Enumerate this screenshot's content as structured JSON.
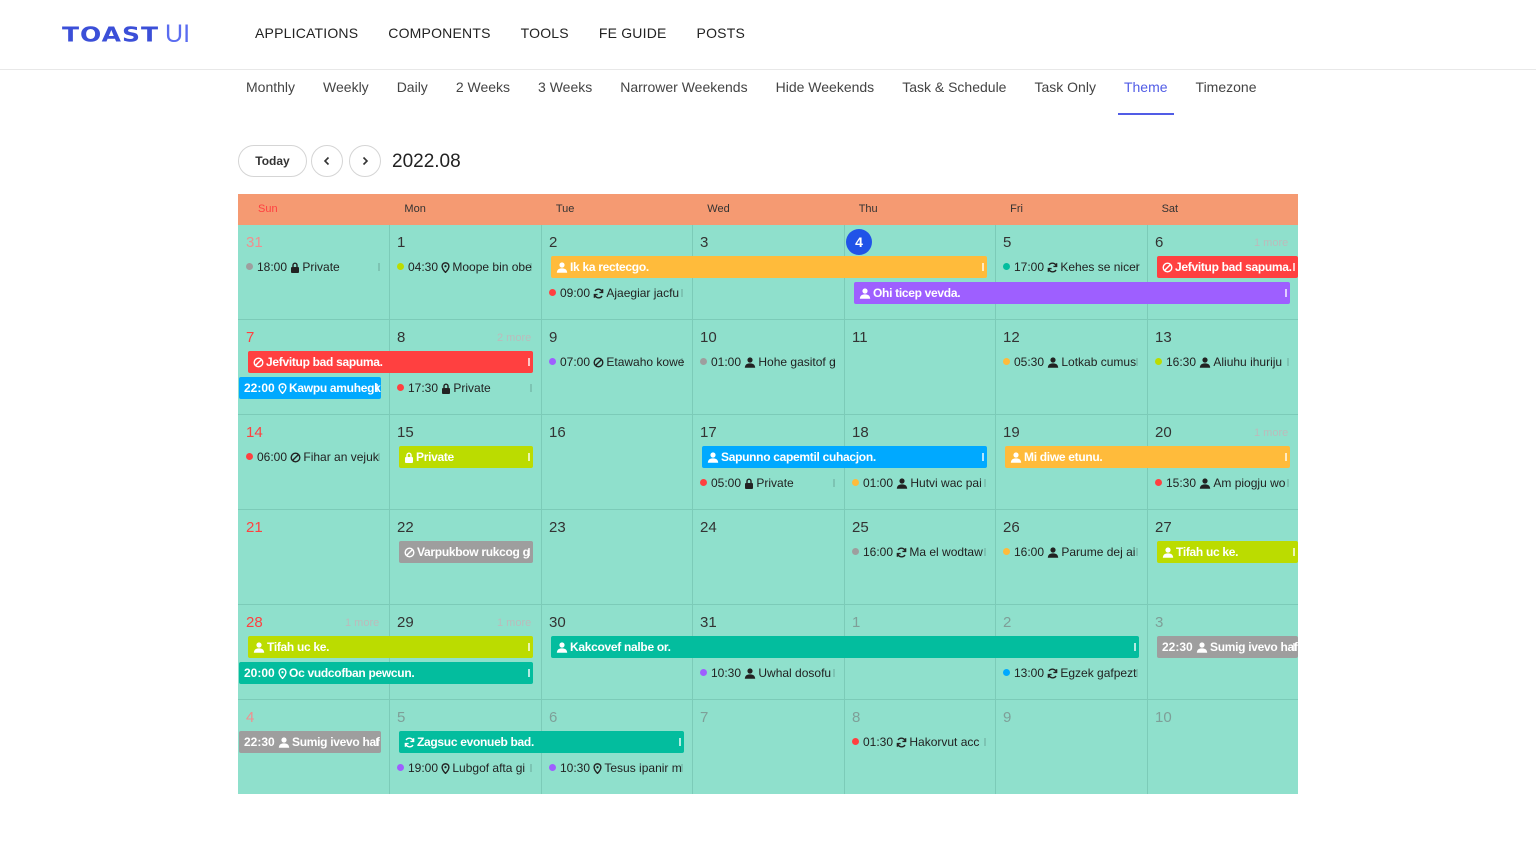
{
  "header": {
    "logo_main": "TOAST",
    "logo_sub": "UI",
    "nav": [
      "APPLICATIONS",
      "COMPONENTS",
      "TOOLS",
      "FE GUIDE",
      "POSTS"
    ]
  },
  "tabs": [
    "Monthly",
    "Weekly",
    "Daily",
    "2 Weeks",
    "3 Weeks",
    "Narrower Weekends",
    "Hide Weekends",
    "Task & Schedule",
    "Task Only",
    "Theme",
    "Timezone"
  ],
  "active_tab": "Theme",
  "toolbar": {
    "today_label": "Today",
    "range": "2022.08"
  },
  "calendar": {
    "day_names": [
      "Sun",
      "Mon",
      "Tue",
      "Wed",
      "Thu",
      "Fri",
      "Sat"
    ],
    "theme": {
      "header_bg": "#f59a72",
      "grid_bg": "#8fe0cc",
      "sunday": "#ff4040",
      "today": "#2053e8"
    },
    "weeks": [
      {
        "dates": [
          "31",
          "1",
          "2",
          "3",
          "4",
          "5",
          "6"
        ],
        "prev_month": [
          0
        ],
        "next_month": [],
        "today": 4,
        "more": {
          "6": "1 more"
        }
      },
      {
        "dates": [
          "7",
          "8",
          "9",
          "10",
          "11",
          "12",
          "13"
        ],
        "prev_month": [],
        "next_month": [],
        "more": {
          "1": "2 more"
        }
      },
      {
        "dates": [
          "14",
          "15",
          "16",
          "17",
          "18",
          "19",
          "20"
        ],
        "prev_month": [],
        "next_month": [],
        "more": {
          "6": "1 more"
        }
      },
      {
        "dates": [
          "21",
          "22",
          "23",
          "24",
          "25",
          "26",
          "27"
        ],
        "prev_month": [],
        "next_month": [],
        "more": {}
      },
      {
        "dates": [
          "28",
          "29",
          "30",
          "31",
          "1",
          "2",
          "3"
        ],
        "prev_month": [],
        "next_month": [
          4,
          5,
          6
        ],
        "more": {
          "0": "1 more",
          "1": "1 more"
        }
      },
      {
        "dates": [
          "4",
          "5",
          "6",
          "7",
          "8",
          "9",
          "10"
        ],
        "prev_month": [],
        "next_month": [
          0,
          1,
          2,
          3,
          4,
          5,
          6
        ],
        "more": {}
      }
    ],
    "events": [
      {
        "week": 0,
        "day": 0,
        "row": 0,
        "kind": "dot",
        "color": "#9e9e9e",
        "time": "18:00",
        "icon": "lock",
        "title": "Private"
      },
      {
        "week": 0,
        "day": 1,
        "row": 0,
        "kind": "dot",
        "color": "#bbdc00",
        "time": "04:30",
        "icon": "pin",
        "title": "Moope bin obe"
      },
      {
        "week": 0,
        "day": 2,
        "row": 0,
        "span": 3,
        "kind": "bar",
        "color": "#ffbb3b",
        "icon": "user",
        "title": "Ik ka rectecgo."
      },
      {
        "week": 0,
        "day": 5,
        "row": 0,
        "kind": "dot",
        "color": "#03bd9e",
        "time": "17:00",
        "icon": "repeat",
        "title": "Kehes se nicer"
      },
      {
        "week": 0,
        "day": 6,
        "row": 0,
        "kind": "bar",
        "color": "#ff4040",
        "icon": "ban",
        "title": "Jefvitup bad sapuma."
      },
      {
        "week": 0,
        "day": 2,
        "row": 1,
        "kind": "dot",
        "color": "#ff4040",
        "time": "09:00",
        "icon": "repeat",
        "title": "Ajaegiar jacfu"
      },
      {
        "week": 0,
        "day": 4,
        "row": 1,
        "span": 3,
        "kind": "bar",
        "color": "#9e5fff",
        "icon": "user",
        "title": "Ohi ticep vevda."
      },
      {
        "week": 1,
        "day": 0,
        "row": 0,
        "span": 2,
        "kind": "bar",
        "color": "#ff4040",
        "icon": "ban",
        "title": "Jefvitup bad sapuma."
      },
      {
        "week": 1,
        "day": 2,
        "row": 0,
        "kind": "dot",
        "color": "#9e5fff",
        "time": "07:00",
        "icon": "ban",
        "title": "Etawaho kowe"
      },
      {
        "week": 1,
        "day": 3,
        "row": 0,
        "kind": "dot",
        "color": "#9e9e9e",
        "time": "01:00",
        "icon": "user",
        "title": "Hohe gasitof g"
      },
      {
        "week": 1,
        "day": 5,
        "row": 0,
        "kind": "dot",
        "color": "#ffbb3b",
        "time": "05:30",
        "icon": "user",
        "title": "Lotkab cumus"
      },
      {
        "week": 1,
        "day": 6,
        "row": 0,
        "kind": "dot",
        "color": "#bbdc00",
        "time": "16:30",
        "icon": "user",
        "title": "Aliuhu ihuriju"
      },
      {
        "week": 1,
        "day": 0,
        "row": 1,
        "kind": "bar",
        "color": "#00a9ff",
        "time": "22:00",
        "icon": "pin",
        "title": "Kawpu amuhegk"
      },
      {
        "week": 1,
        "day": 1,
        "row": 1,
        "kind": "dot",
        "color": "#ff4040",
        "time": "17:30",
        "icon": "lock",
        "title": "Private"
      },
      {
        "week": 2,
        "day": 0,
        "row": 0,
        "kind": "dot",
        "color": "#ff4040",
        "time": "06:00",
        "icon": "ban",
        "title": "Fihar an vejuk"
      },
      {
        "week": 2,
        "day": 1,
        "row": 0,
        "kind": "bar",
        "color": "#bbdc00",
        "icon": "lock",
        "title": "Private"
      },
      {
        "week": 2,
        "day": 3,
        "row": 0,
        "span": 2,
        "kind": "bar",
        "color": "#00a9ff",
        "icon": "user",
        "title": "Sapunno capemtil cuhacjon."
      },
      {
        "week": 2,
        "day": 5,
        "row": 0,
        "span": 2,
        "kind": "bar",
        "color": "#ffbb3b",
        "icon": "user",
        "title": "Mi diwe etunu."
      },
      {
        "week": 2,
        "day": 3,
        "row": 1,
        "kind": "dot",
        "color": "#ff4040",
        "time": "05:00",
        "icon": "lock",
        "title": "Private"
      },
      {
        "week": 2,
        "day": 4,
        "row": 1,
        "kind": "dot",
        "color": "#ffbb3b",
        "time": "01:00",
        "icon": "user",
        "title": "Hutvi wac pai"
      },
      {
        "week": 2,
        "day": 6,
        "row": 1,
        "kind": "dot",
        "color": "#ff4040",
        "time": "15:30",
        "icon": "user",
        "title": "Am piogju wo"
      },
      {
        "week": 3,
        "day": 1,
        "row": 0,
        "kind": "bar",
        "color": "#9e9e9e",
        "icon": "ban",
        "title": "Varpukbow rukcog g"
      },
      {
        "week": 3,
        "day": 4,
        "row": 0,
        "kind": "dot",
        "color": "#9e9e9e",
        "time": "16:00",
        "icon": "repeat",
        "title": "Ma el wodtaw"
      },
      {
        "week": 3,
        "day": 5,
        "row": 0,
        "kind": "dot",
        "color": "#ffbb3b",
        "time": "16:00",
        "icon": "user",
        "title": "Parume dej ai"
      },
      {
        "week": 3,
        "day": 6,
        "row": 0,
        "kind": "bar",
        "color": "#bbdc00",
        "icon": "user",
        "title": "Tifah uc ke."
      },
      {
        "week": 4,
        "day": 0,
        "row": 0,
        "span": 2,
        "kind": "bar",
        "color": "#bbdc00",
        "icon": "user",
        "title": "Tifah uc ke."
      },
      {
        "week": 4,
        "day": 2,
        "row": 0,
        "span": 4,
        "kind": "bar",
        "color": "#03bd9e",
        "icon": "user",
        "title": "Kakcovef nalbe or."
      },
      {
        "week": 4,
        "day": 6,
        "row": 0,
        "kind": "bar",
        "color": "#9e9e9e",
        "time": "22:30",
        "icon": "user",
        "title": "Sumig ivevo haf"
      },
      {
        "week": 4,
        "day": 0,
        "row": 1,
        "span": 2,
        "kind": "bar",
        "color": "#03bd9e",
        "time": "20:00",
        "icon": "pin",
        "title": "Oc vudcofban pewcun."
      },
      {
        "week": 4,
        "day": 3,
        "row": 1,
        "kind": "dot",
        "color": "#9e5fff",
        "time": "10:30",
        "icon": "user",
        "title": "Uwhal dosofu"
      },
      {
        "week": 4,
        "day": 5,
        "row": 1,
        "kind": "dot",
        "color": "#00a9ff",
        "time": "13:00",
        "icon": "repeat",
        "title": "Egzek gafpezt"
      },
      {
        "week": 5,
        "day": 0,
        "row": 0,
        "kind": "bar",
        "color": "#9e9e9e",
        "time": "22:30",
        "icon": "user",
        "title": "Sumig ivevo haf"
      },
      {
        "week": 5,
        "day": 1,
        "row": 0,
        "span": 2,
        "kind": "bar",
        "color": "#03bd9e",
        "icon": "repeat",
        "title": "Zagsuc evonueb bad."
      },
      {
        "week": 5,
        "day": 4,
        "row": 0,
        "kind": "dot",
        "color": "#ff4040",
        "time": "01:30",
        "icon": "repeat",
        "title": "Hakorvut acc"
      },
      {
        "week": 5,
        "day": 1,
        "row": 1,
        "kind": "dot",
        "color": "#9e5fff",
        "time": "19:00",
        "icon": "pin",
        "title": "Lubgof afta gi"
      },
      {
        "week": 5,
        "day": 2,
        "row": 1,
        "kind": "dot",
        "color": "#9e5fff",
        "time": "10:30",
        "icon": "pin",
        "title": "Tesus ipanir m"
      }
    ]
  }
}
